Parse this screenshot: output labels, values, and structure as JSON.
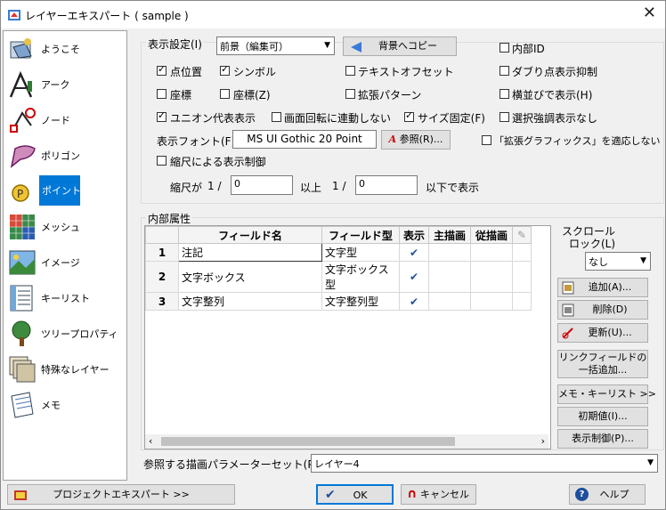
{
  "window": {
    "title": "レイヤーエキスパート ( sample )"
  },
  "sidebar": {
    "items": [
      {
        "label": "ようこそ",
        "icon": "welcome-icon"
      },
      {
        "label": "アーク",
        "icon": "arc-icon"
      },
      {
        "label": "ノード",
        "icon": "node-icon"
      },
      {
        "label": "ポリゴン",
        "icon": "polygon-icon"
      },
      {
        "label": "ポイント",
        "icon": "point-icon"
      },
      {
        "label": "メッシュ",
        "icon": "mesh-icon"
      },
      {
        "label": "イメージ",
        "icon": "image-icon"
      },
      {
        "label": "キーリスト",
        "icon": "keylist-icon"
      },
      {
        "label": "ツリープロパティ",
        "icon": "tree-icon"
      },
      {
        "label": "特殊なレイヤー",
        "icon": "special-layer-icon"
      },
      {
        "label": "メモ",
        "icon": "memo-icon"
      }
    ],
    "selected_index": 4
  },
  "display": {
    "label": "表示設定(I)",
    "mode_value": "前景（編集可）",
    "copy_bg_button": "背景へコピー",
    "internal_id": {
      "label": "内部ID",
      "checked": false
    },
    "point_position": {
      "label": "点位置",
      "checked": true
    },
    "symbol": {
      "label": "シンボル",
      "checked": true
    },
    "text_offset": {
      "label": "テキストオフセット",
      "checked": false
    },
    "dup_point_suppress": {
      "label": "ダブり点表示抑制",
      "checked": false
    },
    "coord": {
      "label": "座標",
      "checked": false
    },
    "coord_z": {
      "label": "座標(Z)",
      "checked": false
    },
    "ext_pattern": {
      "label": "拡張パターン",
      "checked": false
    },
    "horizontal": {
      "label": "横並びで表示(H)",
      "checked": false
    },
    "union_rep": {
      "label": "ユニオン代表表示",
      "checked": true
    },
    "screen_rotate": {
      "label": "画面回転に連動しない",
      "checked": false
    },
    "size_fixed": {
      "label": "サイズ固定(F)",
      "checked": true
    },
    "selection_emph": {
      "label": "選択強調表示なし",
      "checked": false
    },
    "font_label": "表示フォント(F)",
    "font_value": "MS UI Gothic 20 Point",
    "browse_button": "参照(R)...",
    "ext_graphics": {
      "label": "「拡張グラフィックス」を適応しない",
      "checked": false
    },
    "scale_control": {
      "label": "縮尺による表示制御",
      "checked": false
    },
    "scale_label_prefix": "縮尺が",
    "scale_ratio": "1 /",
    "scale_min": "0",
    "scale_above": "以上",
    "scale_ratio2": "1 /",
    "scale_max": "0",
    "scale_below": "以下で表示"
  },
  "attributes": {
    "label": "内部属性",
    "columns": [
      "フィールド名",
      "フィールド型",
      "表示",
      "主描画",
      "従描画"
    ],
    "rows": [
      {
        "num": "1",
        "name": "注記",
        "type": "文字型",
        "show": true
      },
      {
        "num": "2",
        "name": "文字ボックス",
        "type": "文字ボックス型",
        "show": true
      },
      {
        "num": "3",
        "name": "文字整列",
        "type": "文字整列型",
        "show": true
      }
    ]
  },
  "scroll_lock": {
    "label1": "スクロール",
    "label2": "ロック(L)",
    "value": "なし"
  },
  "right_buttons": {
    "add": "追加(A)...",
    "delete": "削除(D)",
    "update": "更新(U)...",
    "link_add_1": "リンクフィールドの",
    "link_add_2": "一括追加...",
    "memo_keylist": "メモ・キーリスト >>",
    "initial": "初期値(I)...",
    "display_control": "表示制御(P)..."
  },
  "param_set": {
    "label": "参照する描画パラメーターセット(P)",
    "value": "レイヤー4"
  },
  "footer": {
    "project_expert": "プロジェクトエキスパート >>",
    "ok": "OK",
    "cancel": "キャンセル",
    "help": "ヘルプ"
  },
  "colors": {
    "selection": "#0078d7",
    "check_blue": "#1f4f9c"
  }
}
